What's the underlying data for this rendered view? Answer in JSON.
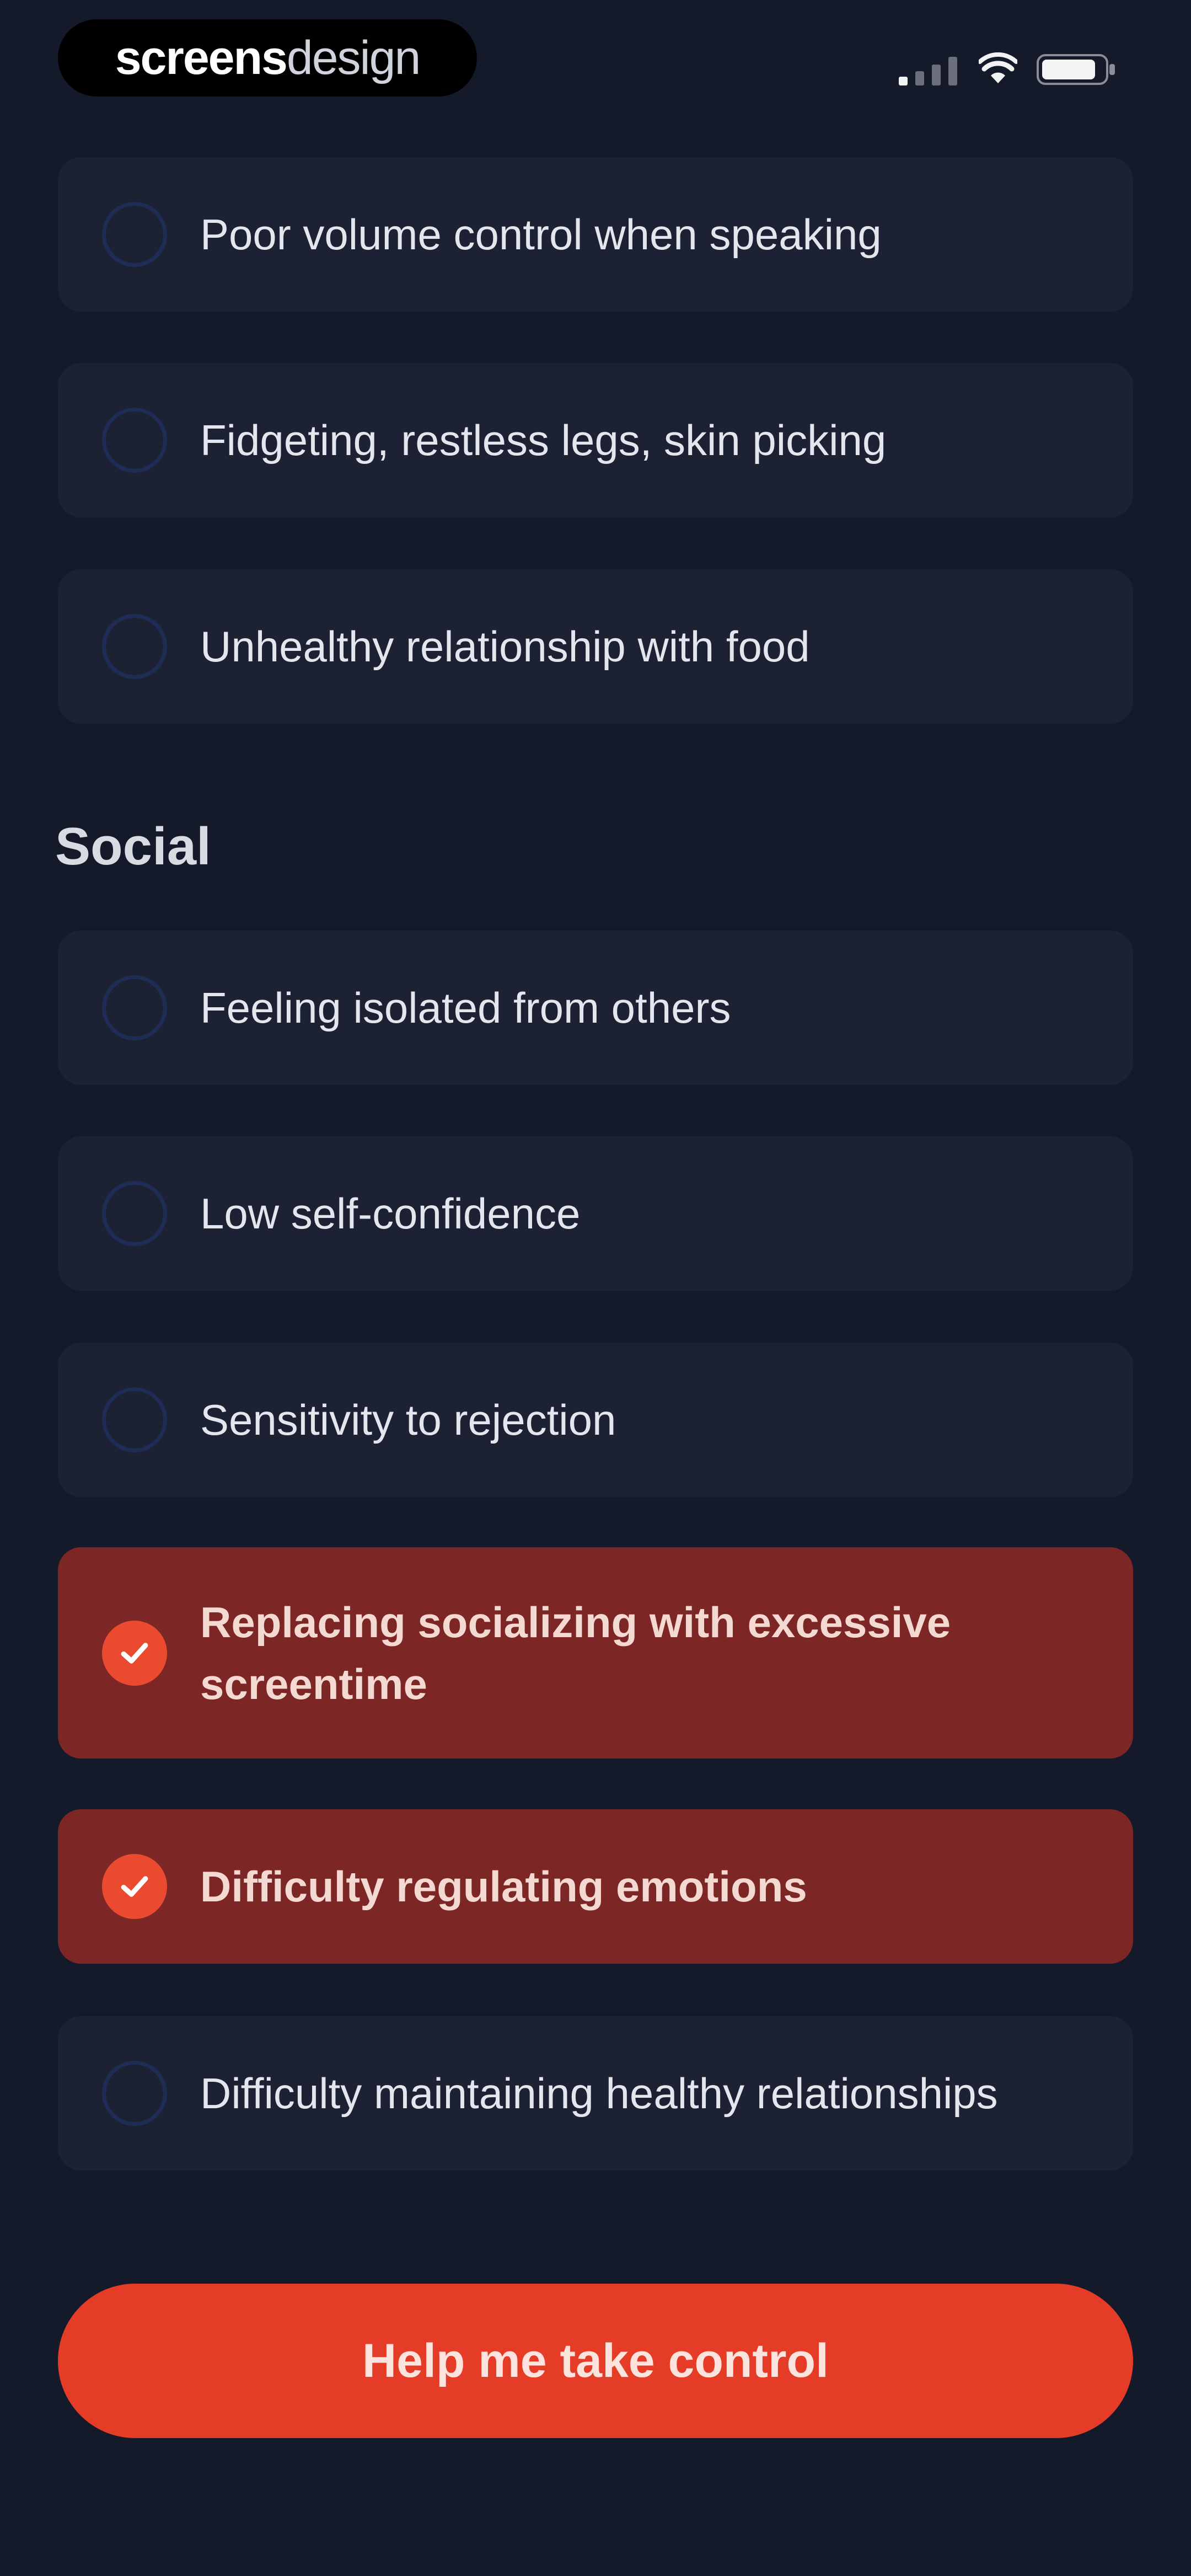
{
  "status_bar": {
    "brand_primary": "screens",
    "brand_secondary": "design",
    "icons": [
      "signal-icon",
      "wifi-icon",
      "battery-icon"
    ]
  },
  "options_top": [
    {
      "label": "Poor volume control when speaking",
      "selected": false
    },
    {
      "label": "Fidgeting, restless legs, skin picking",
      "selected": false
    },
    {
      "label": "Unhealthy relationship with food",
      "selected": false
    }
  ],
  "social": {
    "heading": "Social",
    "options": [
      {
        "label": "Feeling isolated from others",
        "selected": false
      },
      {
        "label": "Low self-confidence",
        "selected": false
      },
      {
        "label": "Sensitivity to rejection",
        "selected": false
      },
      {
        "label": "Replacing socializing with excessive screentime",
        "selected": true
      },
      {
        "label": "Difficulty regulating emotions",
        "selected": true
      },
      {
        "label": "Difficulty maintaining healthy relationships",
        "selected": false
      }
    ]
  },
  "cta": {
    "label": "Help me take control"
  },
  "colors": {
    "background": "#151a2b",
    "card": "#1d2134",
    "card_selected": "#7c2726",
    "accent": "#e43c26",
    "check": "#ea4a30"
  }
}
